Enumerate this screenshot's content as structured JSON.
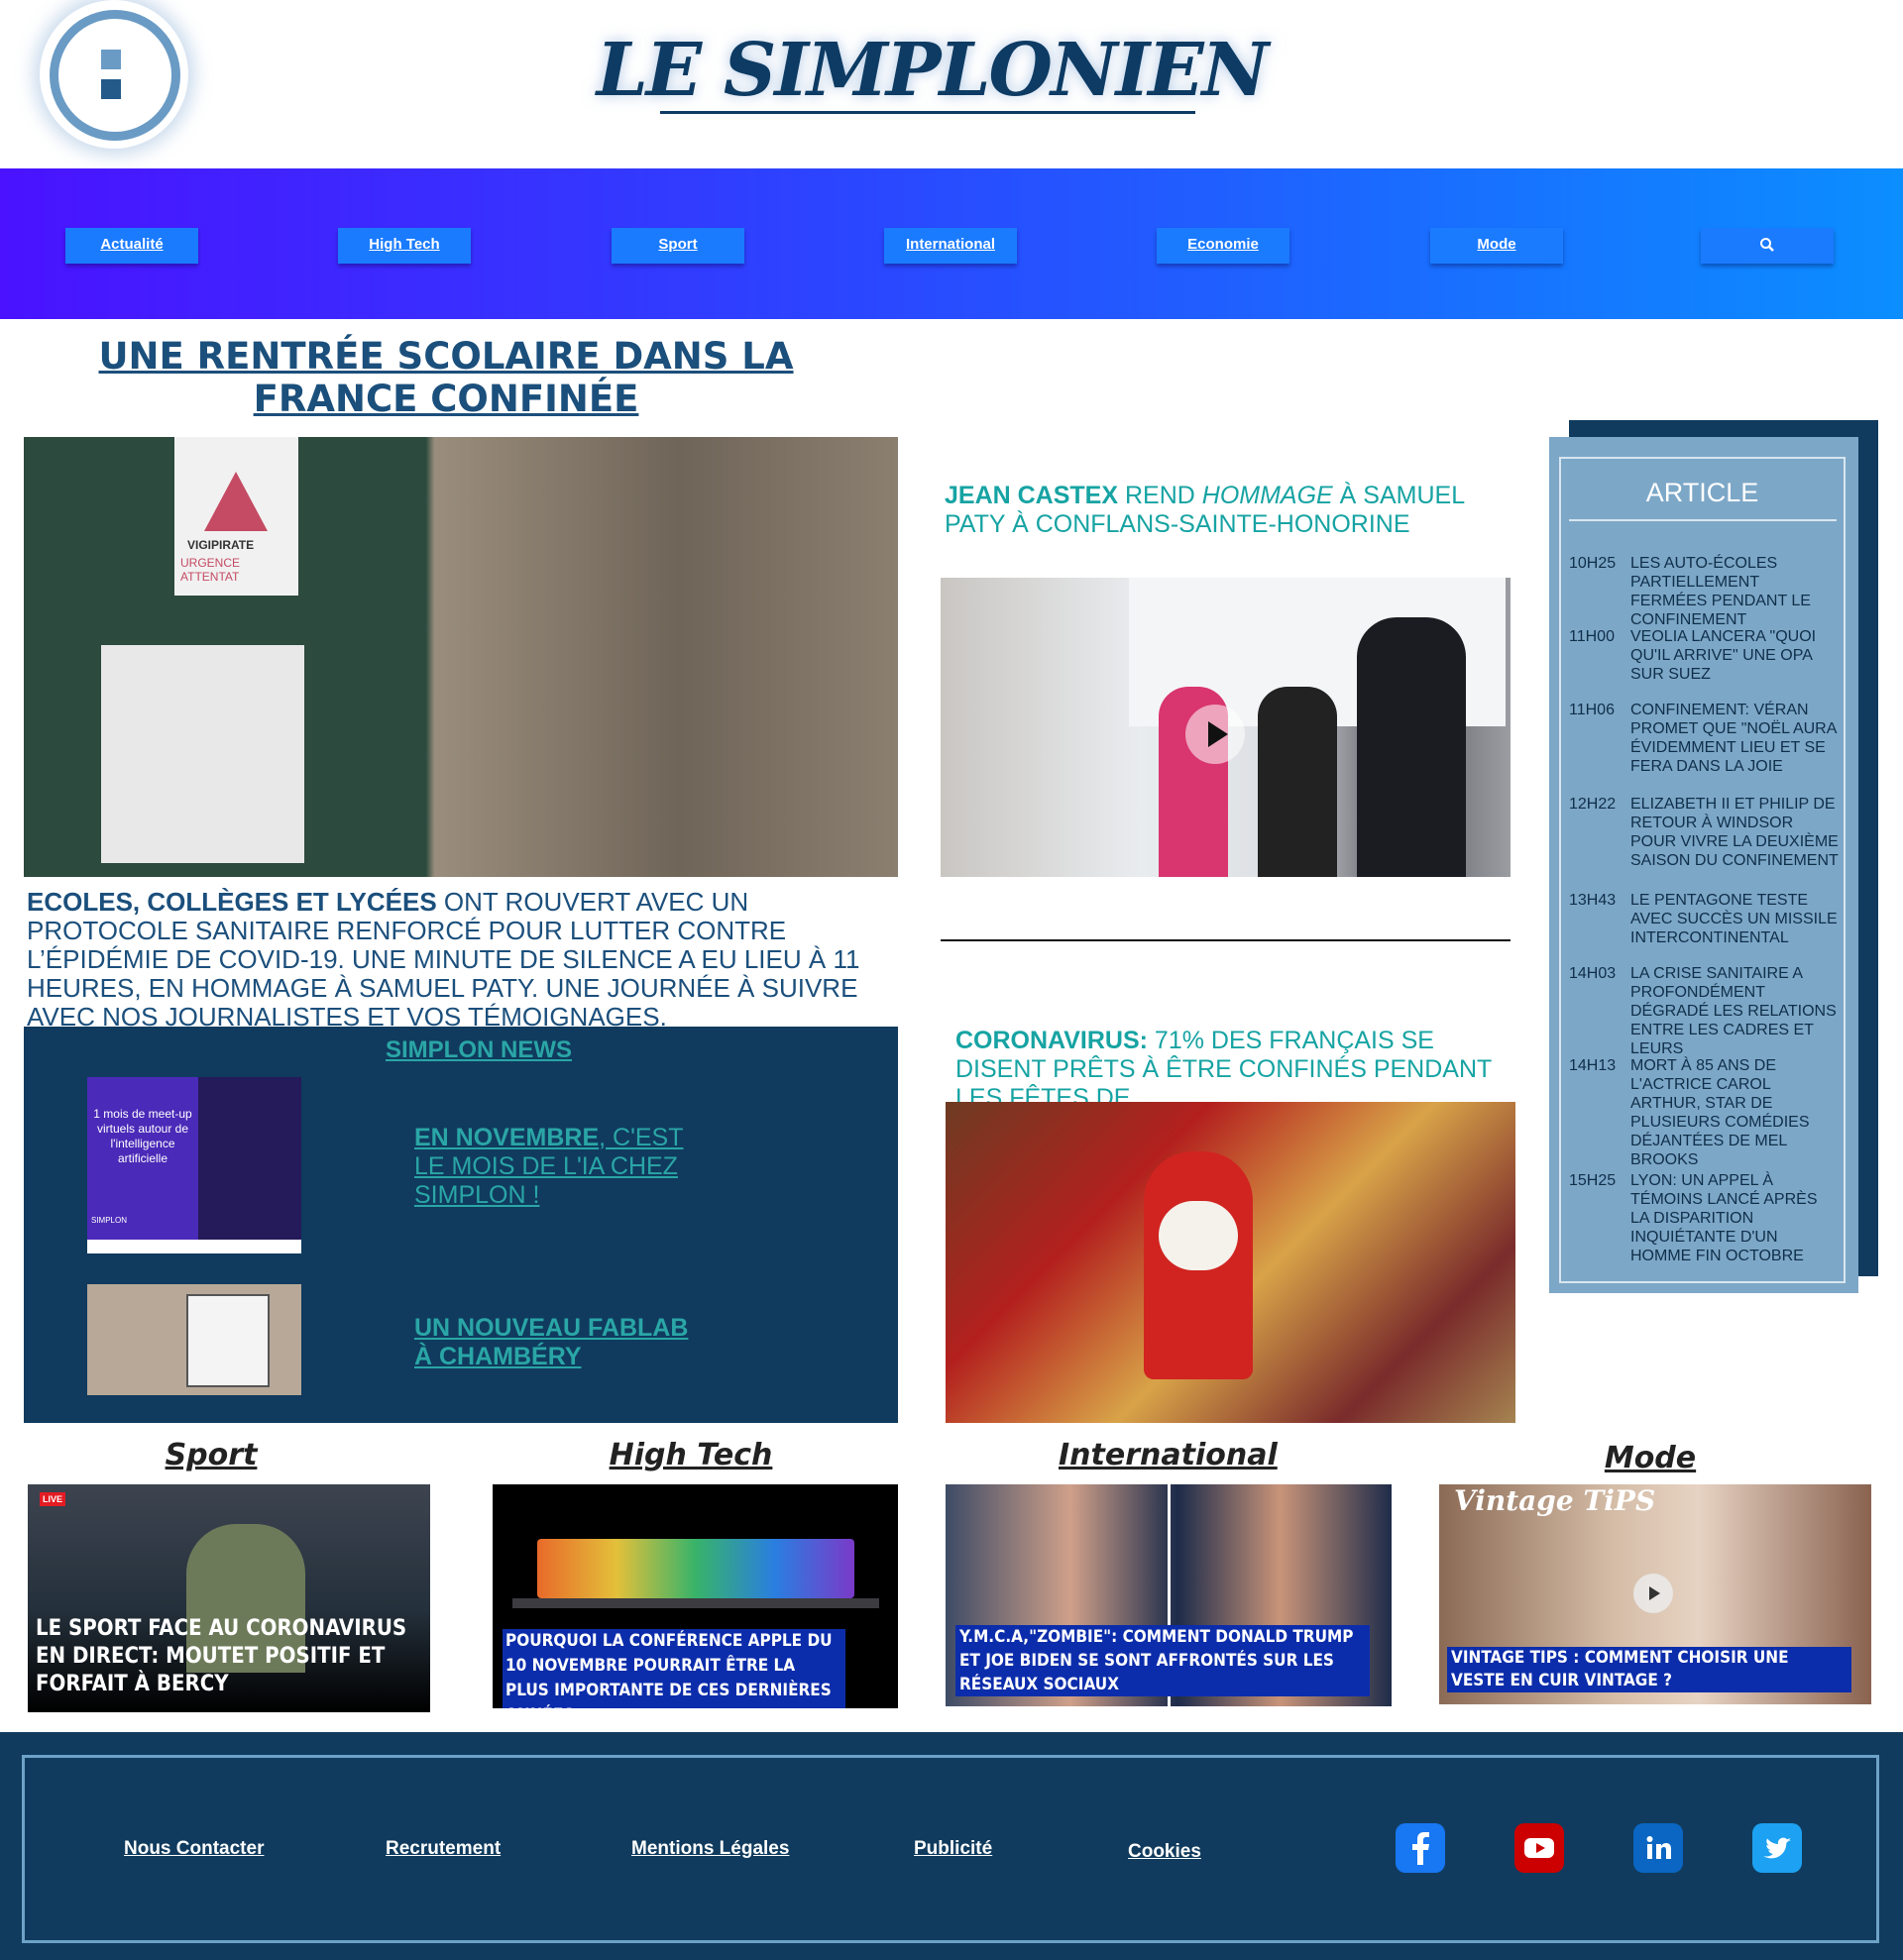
{
  "header": {
    "site_title": "LE SIMPLONIEN"
  },
  "nav": {
    "items": [
      "Actualité",
      "High Tech",
      "Sport",
      "International",
      "Economie",
      "Mode"
    ],
    "search_icon": "search-icon"
  },
  "main": {
    "headline": "UNE RENTRÉE SCOLAIRE DANS LA FRANCE CONFINÉE",
    "photo_texts": {
      "vigipirate": "VIGIPIRATE",
      "urgence": "URGENCE ATTENTAT"
    },
    "lead_bold": "ECOLES, COLLÈGES ET LYCÉES",
    "lead_text": " ONT ROUVERT AVEC UN PROTOCOLE SANITAIRE RENFORCÉ POUR LUTTER CONTRE L’ÉPIDÉMIE DE COVID-19. UNE MINUTE DE SILENCE A EU LIEU À 11 HEURES, EN HOMMAGE À SAMUEL PATY. UNE JOURNÉE À SUIVRE AVEC NOS JOURNALISTES ET VOS TÉMOIGNAGES."
  },
  "simplon_news": {
    "title": "SIMPLON NEWS",
    "image1_text": "1 mois de meet-up virtuels autour de l'intelligence artificielle",
    "image1_brand": "SIMPLON",
    "item1_bold": "EN NOVEMBRE",
    "item1_text": ", C'EST LE MOIS DE L'IA CHEZ SIMPLON !",
    "item2_bold": "UN NOUVEAU FABLAB À CHAMBÉRY"
  },
  "middle": {
    "story1_bold": "JEAN CASTEX",
    "story1_mid": " REND ",
    "story1_italic": "HOMMAGE",
    "story1_end": " À SAMUEL PATY À CONFLANS-SAINTE-HONORINE",
    "story2_bold": "CORONAVIRUS:",
    "story2_text": " 71% DES FRANÇAIS SE DISENT PRÊTS À ÊTRE CONFINÉS PENDANT LES FÊTES DE"
  },
  "article": {
    "title": "ARTICLE",
    "items": [
      {
        "time": "10H25",
        "headline": "LES AUTO-ÉCOLES PARTIELLEMENT FERMÉES PENDANT LE CONFINEMENT"
      },
      {
        "time": "11H00",
        "headline": "VEOLIA LANCERA \"QUOI QU'IL ARRIVE\" UNE OPA SUR SUEZ"
      },
      {
        "time": "11H06",
        "headline": "CONFINEMENT: VÉRAN PROMET QUE \"NOËL AURA ÉVIDEMMENT LIEU ET SE FERA DANS LA JOIE"
      },
      {
        "time": "12H22",
        "headline": "ELIZABETH II ET PHILIP DE RETOUR À WINDSOR POUR VIVRE LA DEUXIÈME SAISON DU CONFINEMENT"
      },
      {
        "time": "13H43",
        "headline": "LE PENTAGONE TESTE AVEC SUCCÈS UN MISSILE INTERCONTINENTAL"
      },
      {
        "time": "14H03",
        "headline": "LA CRISE SANITAIRE A PROFONDÉMENT DÉGRADÉ LES RELATIONS ENTRE LES CADRES ET LEURS"
      },
      {
        "time": "14H13",
        "headline": "MORT À 85 ANS DE L'ACTRICE CAROL ARTHUR, STAR DE PLUSIEURS COMÉDIES DÉJANTÉES DE MEL BROOKS"
      },
      {
        "time": "15H25",
        "headline": "LYON: UN APPEL À TÉMOINS LANCÉ APRÈS LA DISPARITION INQUIÉTANTE D'UN HOMME FIN OCTOBRE"
      }
    ]
  },
  "categories": {
    "sport": {
      "title": "Sport",
      "live": "LIVE",
      "caption": "LE SPORT FACE AU CORONAVIRUS EN DIRECT: MOUTET POSITIF ET FORFAIT À BERCY"
    },
    "hightech": {
      "title": "High Tech",
      "caption": "POURQUOI LA CONFÉRENCE APPLE DU 10 NOVEMBRE POURRAIT ÊTRE LA PLUS IMPORTANTE DE CES DERNIÈRES ANNÉES"
    },
    "international": {
      "title": "International",
      "caption": "Y.M.C.A,\"ZOMBIE\": COMMENT DONALD TRUMP ET JOE BIDEN SE SONT AFFRONTÉS SUR LES RÉSEAUX SOCIAUX"
    },
    "mode": {
      "title": "Mode",
      "brand": "Vintage TiPS",
      "caption": "VINTAGE TIPS : COMMENT CHOISIR UNE VESTE EN CUIR VINTAGE ?"
    }
  },
  "footer": {
    "links": [
      "Nous Contacter",
      "Recrutement",
      "Mentions Légales",
      "Publicité",
      "Cookies"
    ],
    "social": [
      {
        "icon": "facebook-icon",
        "color": "#1877f2"
      },
      {
        "icon": "youtube-icon",
        "color": "#cc0000"
      },
      {
        "icon": "linkedin-icon",
        "color": "#0a66c2"
      },
      {
        "icon": "twitter-icon",
        "color": "#1da1f2"
      }
    ]
  },
  "colors": {
    "brand_navy": "#0d3b63",
    "teal": "#17a3a3",
    "nav_gradient_start": "#4a12ff",
    "nav_gradient_end": "#0b8eff",
    "sidebar": "#7da7c7",
    "caption_bg": "#0c2dab"
  }
}
